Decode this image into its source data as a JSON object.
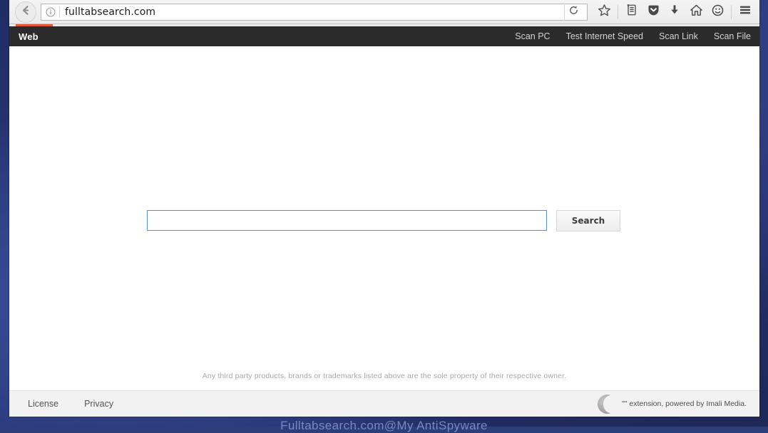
{
  "browser": {
    "url": "fulltabsearch.com",
    "back_icon": "back-arrow-icon",
    "identity_icon": "info-icon",
    "reload_icon": "reload-icon",
    "toolbar_icons": [
      {
        "name": "bookmark-star-icon",
        "glyph": "star"
      },
      {
        "name": "library-icon",
        "glyph": "library"
      },
      {
        "name": "pocket-icon",
        "glyph": "pocket"
      },
      {
        "name": "downloads-icon",
        "glyph": "download"
      },
      {
        "name": "home-icon",
        "glyph": "home"
      },
      {
        "name": "sync-account-icon",
        "glyph": "smiley"
      },
      {
        "name": "menu-icon",
        "glyph": "hamburger"
      }
    ],
    "loading_progress": "partial",
    "accent_color": "#e0573e"
  },
  "site": {
    "brand": "Web",
    "nav_links": [
      "Scan PC",
      "Test Internet Speed",
      "Scan Link",
      "Scan File"
    ],
    "search": {
      "value": "",
      "placeholder": "",
      "button_label": "Search",
      "focus_border_color": "#5b8fd4"
    },
    "disclaimer": "Any third party products, brands or trademarks listed above are the sole property of their respective owner.",
    "footer": {
      "links": [
        "License",
        "Privacy"
      ],
      "logo_icon": "crescent-moon-icon",
      "credit": "\"\" extension, powered by Imali Media."
    }
  },
  "watermark": "Fulltabsearch.com@My AntiSpyware"
}
